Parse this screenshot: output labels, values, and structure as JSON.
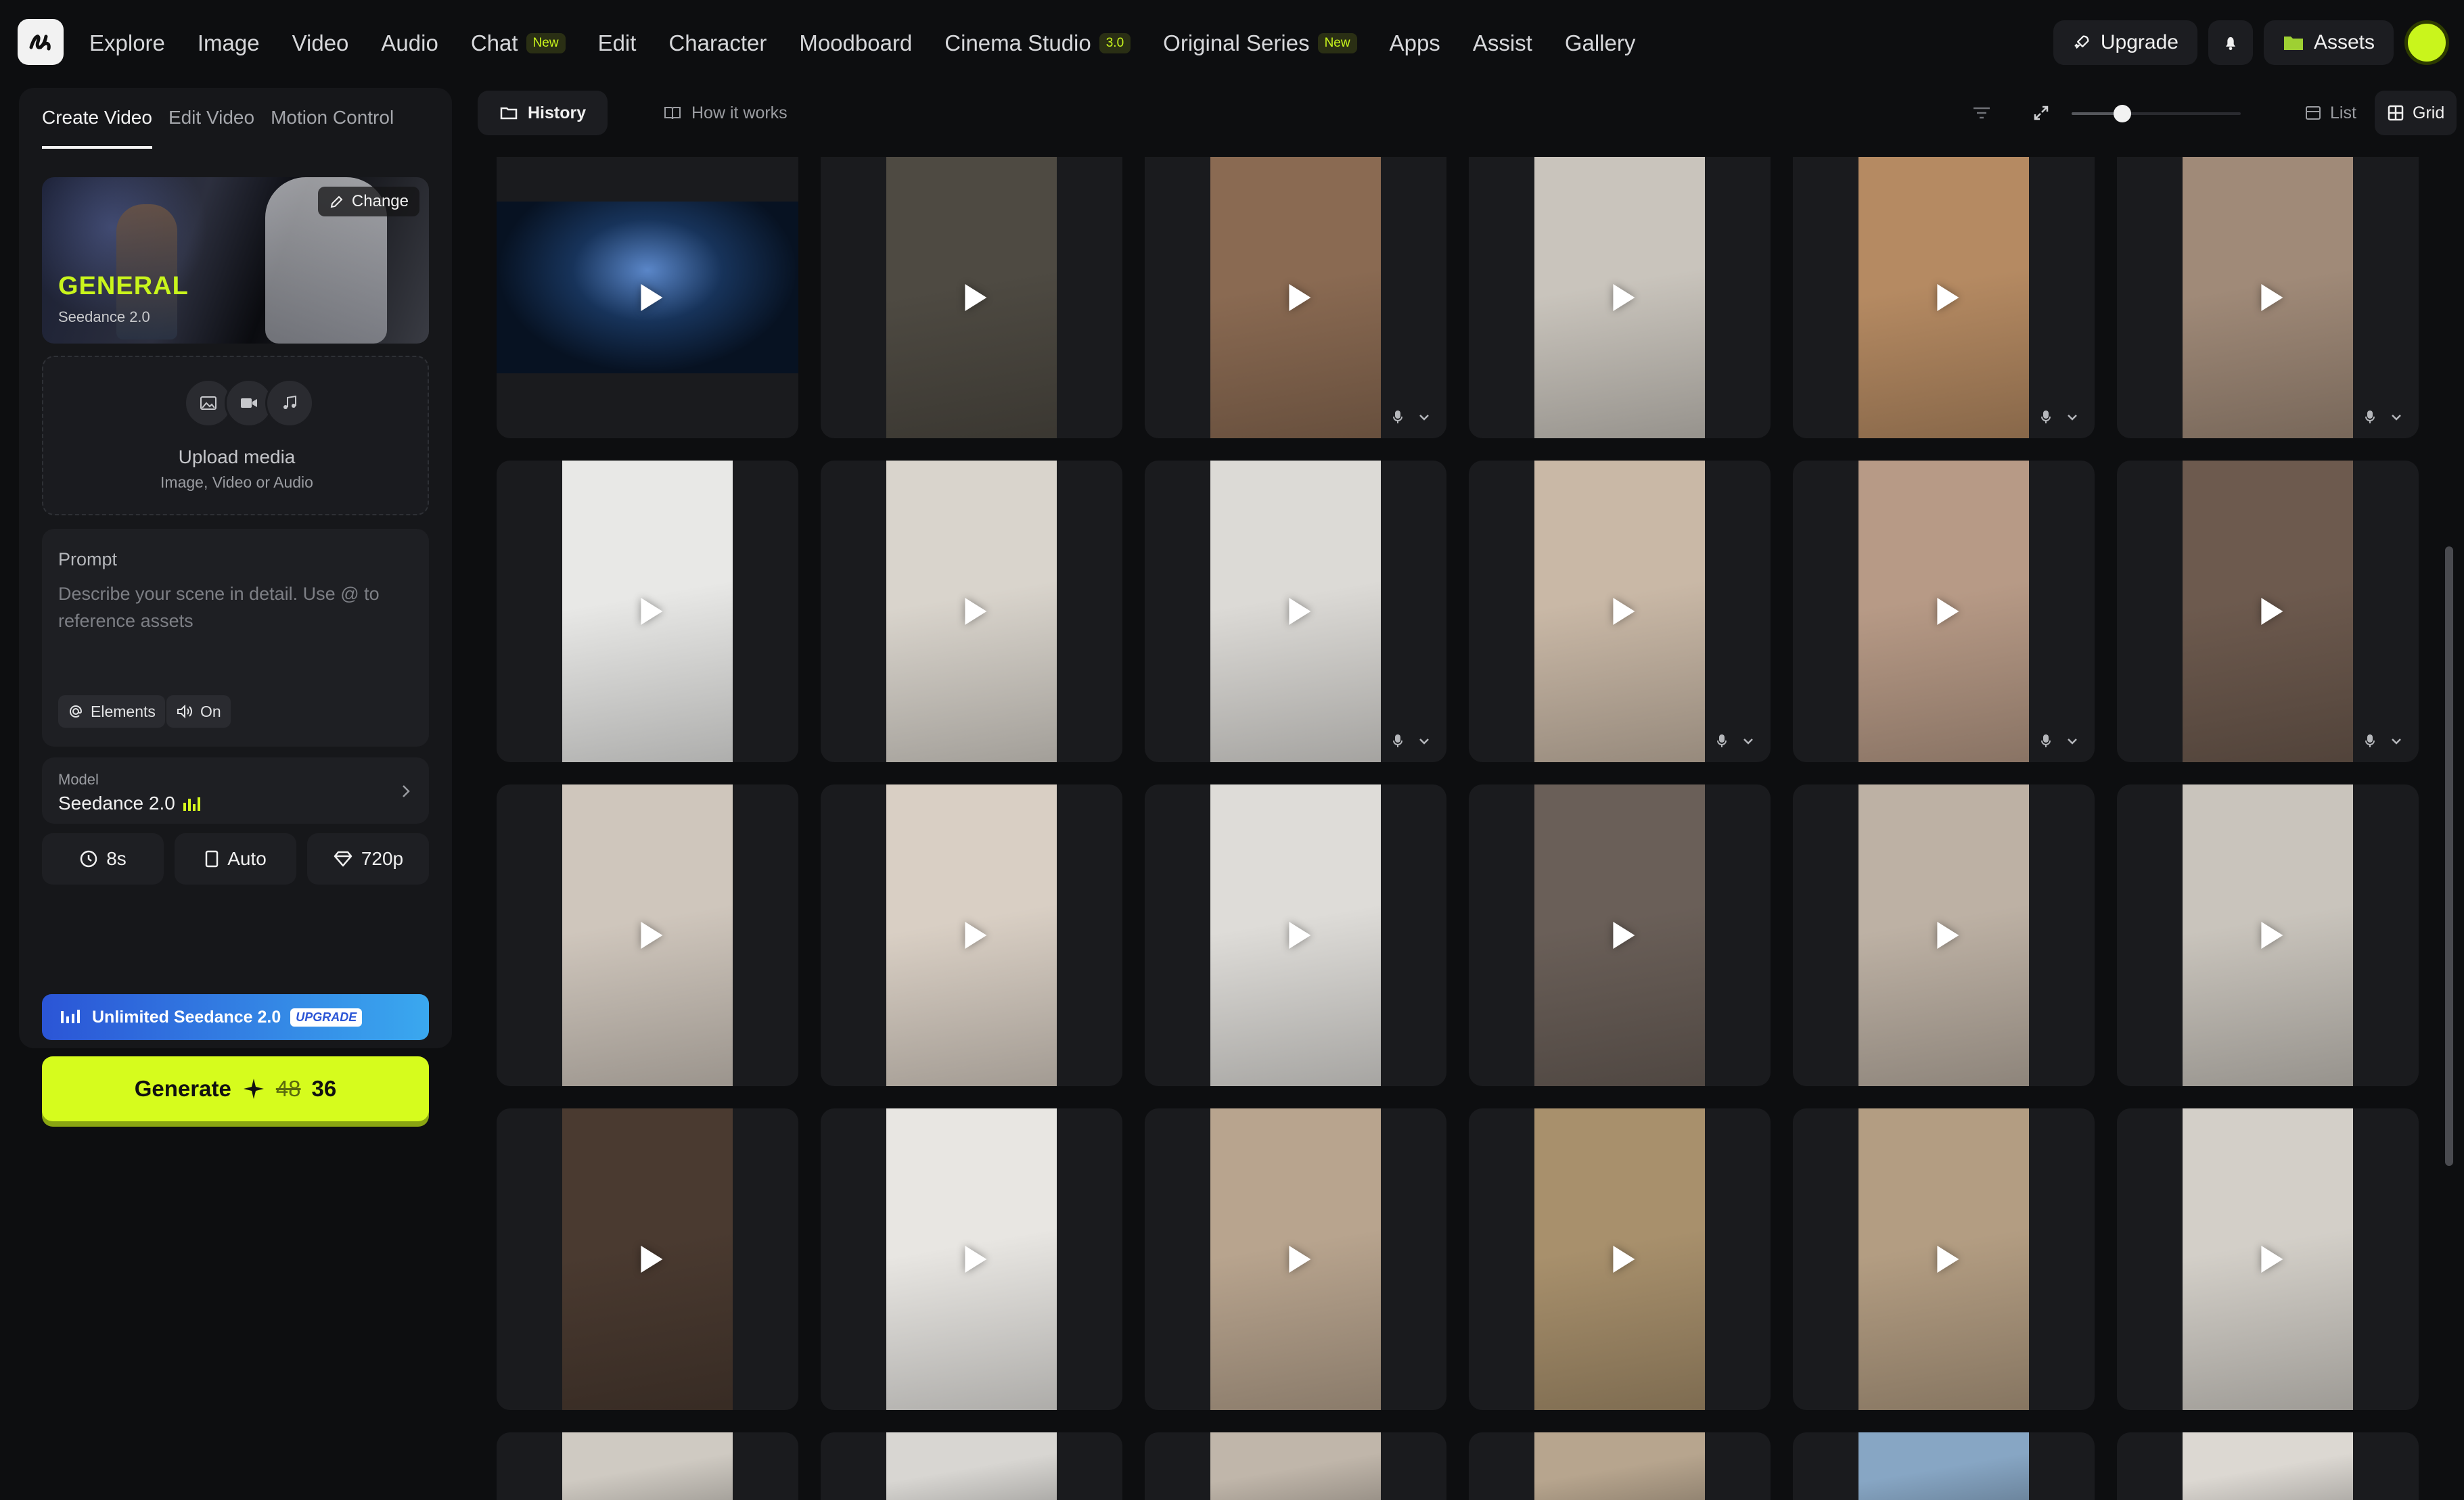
{
  "nav": {
    "items": [
      {
        "label": "Explore"
      },
      {
        "label": "Image"
      },
      {
        "label": "Video"
      },
      {
        "label": "Audio"
      },
      {
        "label": "Chat",
        "badge": "New"
      },
      {
        "label": "Edit"
      },
      {
        "label": "Character"
      },
      {
        "label": "Moodboard"
      },
      {
        "label": "Cinema Studio",
        "badge": "3.0"
      },
      {
        "label": "Original Series",
        "badge": "New"
      },
      {
        "label": "Apps"
      },
      {
        "label": "Assist"
      },
      {
        "label": "Gallery"
      }
    ],
    "upgrade": "Upgrade",
    "assets": "Assets"
  },
  "left": {
    "tabs": [
      "Create Video",
      "Edit Video",
      "Motion Control"
    ],
    "hero": {
      "title": "GENERAL",
      "subtitle": "Seedance 2.0",
      "change": "Change"
    },
    "upload": {
      "title": "Upload media",
      "subtitle": "Image, Video or Audio"
    },
    "prompt": {
      "label": "Prompt",
      "placeholder": "Describe your scene in detail. Use @ to reference assets",
      "elements": "Elements",
      "audio": "On"
    },
    "model": {
      "label": "Model",
      "value": "Seedance 2.0"
    },
    "settings": {
      "duration": "8s",
      "aspect": "Auto",
      "resolution": "720p"
    },
    "unlimited": {
      "label": "Unlimited Seedance 2.0",
      "tag": "UPGRADE"
    },
    "generate": {
      "label": "Generate",
      "old_cost": "48",
      "cost": "36"
    }
  },
  "toolbar": {
    "history": "History",
    "how": "How it works",
    "list": "List",
    "grid": "Grid",
    "zoom": 0.3
  },
  "colors": {
    "accent": "#d6fc1d",
    "bg": "#0d0e10",
    "panel": "#16171a"
  },
  "thumbs": [
    [
      "#0a1424",
      "#4e4a42",
      "#8a6a52",
      "#c9c4bc",
      "#b58a62",
      "#a08a78"
    ],
    [
      "#e8e8e6",
      "#d9d4cc",
      "#dcdad6",
      "#c9b8a6",
      "#b79a86",
      "#6d5a4e"
    ],
    [
      "#cfc6bc",
      "#d9cfc4",
      "#dedcd8",
      "#6a5f58",
      "#bdb1a4",
      "#c9c4bc"
    ],
    [
      "#4a3a30",
      "#e8e6e2",
      "#b8a48e",
      "#a8906c",
      "#b39d82",
      "#d3cfc8"
    ],
    [
      "#cfcac2",
      "#d8d6d2",
      "#c0b6aa",
      "#b7a58e",
      "#87a6c4",
      "#dcd8d2"
    ]
  ]
}
